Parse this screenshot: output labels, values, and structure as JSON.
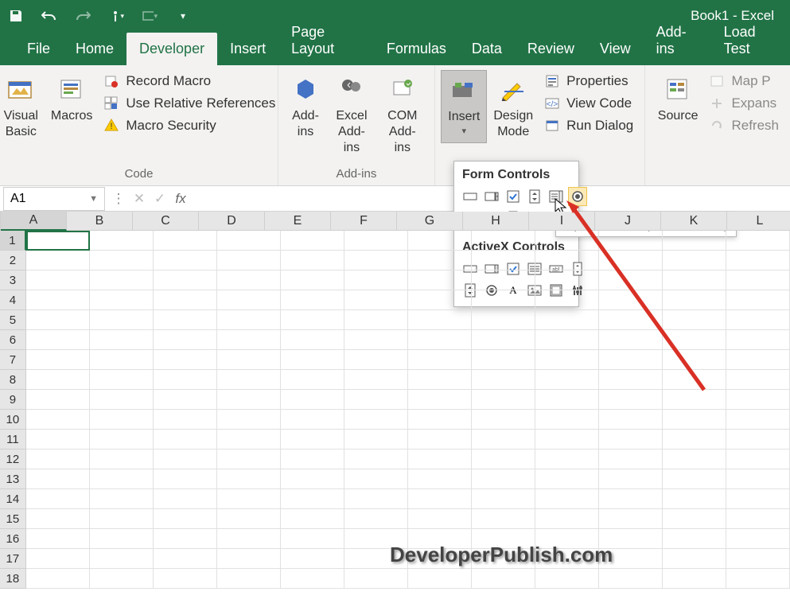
{
  "title": "Book1 - Excel",
  "qat": [
    "save",
    "undo",
    "redo",
    "touch",
    "object",
    "customize"
  ],
  "tabs": [
    "File",
    "Home",
    "Developer",
    "Insert",
    "Page Layout",
    "Formulas",
    "Data",
    "Review",
    "View",
    "Add-ins",
    "Load Test"
  ],
  "active_tab": "Developer",
  "ribbon": {
    "code": {
      "vb": "Visual\nBasic",
      "macros": "Macros",
      "record": "Record Macro",
      "relref": "Use Relative References",
      "security": "Macro Security",
      "label": "Code"
    },
    "addins": {
      "addins": "Add-\nins",
      "excel": "Excel\nAdd-ins",
      "com": "COM\nAdd-ins",
      "label": "Add-ins"
    },
    "controls": {
      "insert": "Insert",
      "design": "Design\nMode",
      "props": "Properties",
      "viewcode": "View Code",
      "rundlg": "Run Dialog"
    },
    "xml": {
      "source": "Source",
      "map": "Map P",
      "expand": "Expans",
      "refresh": "Refresh"
    }
  },
  "popup": {
    "form_header": "Form Controls",
    "activex_header": "ActiveX Controls",
    "tooltip": "Option Button (Form Control)"
  },
  "namebox": "A1",
  "cols": [
    "A",
    "B",
    "C",
    "D",
    "E",
    "F",
    "G",
    "H",
    "I",
    "J",
    "K",
    "L"
  ],
  "rowcount": 18,
  "watermark": "DeveloperPublish.com"
}
